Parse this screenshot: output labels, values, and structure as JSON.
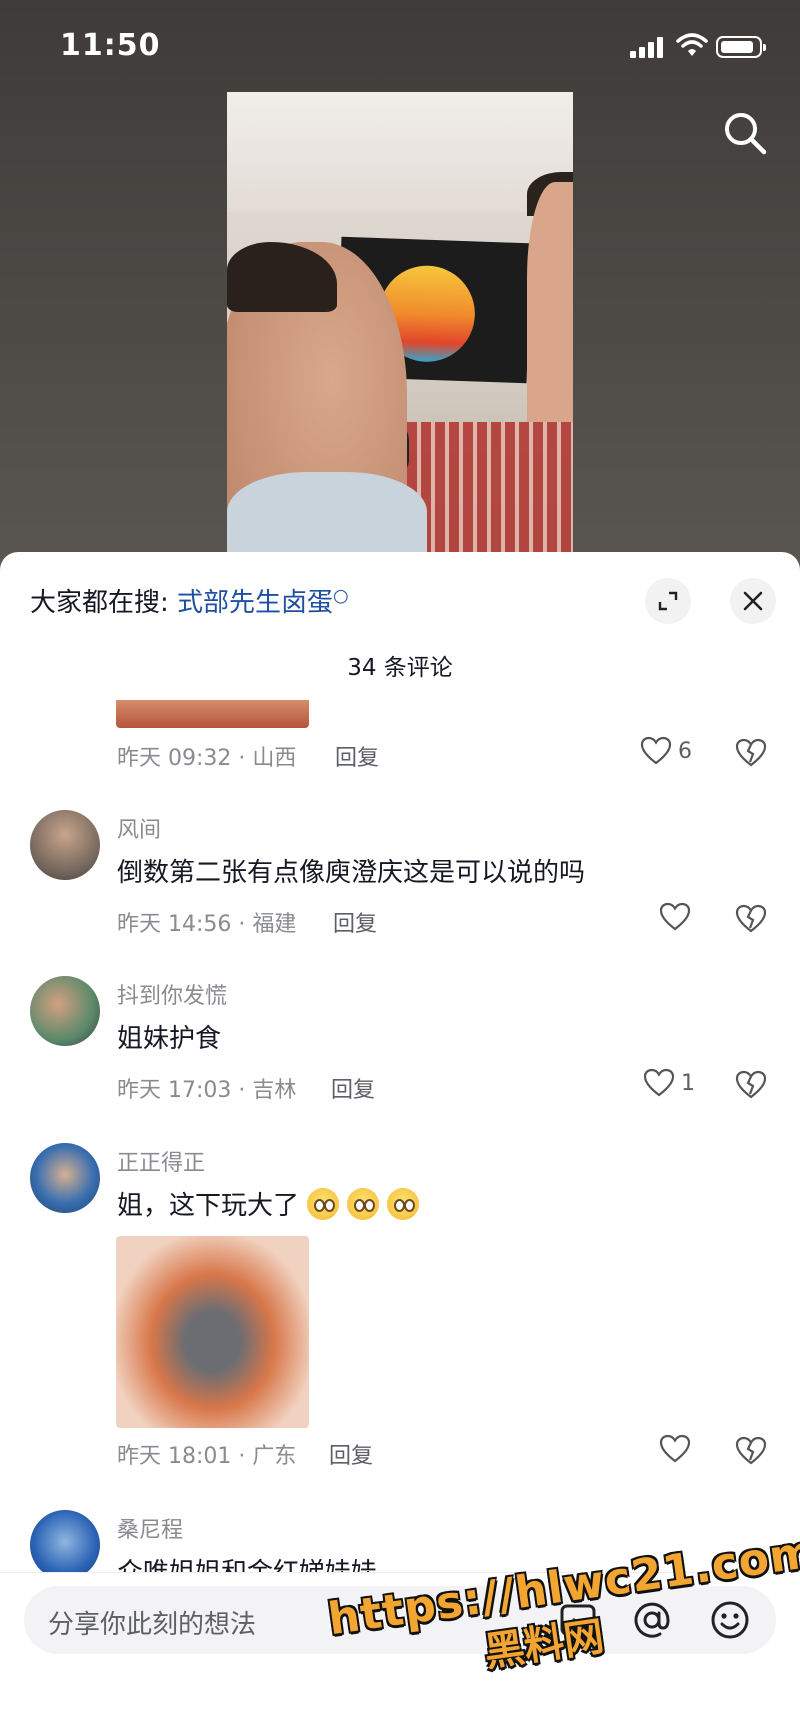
{
  "status_bar": {
    "time": "11:50"
  },
  "header": {
    "hot_search_prefix": "大家都在搜:",
    "hot_search_keyword": "式部先生卤蛋"
  },
  "comments_count_label": "34 条评论",
  "comments": [
    {
      "username": "",
      "text": "",
      "time": "昨天 09:32",
      "location": "· 山西",
      "reply": "回复",
      "likes": "6"
    },
    {
      "username": "风间",
      "text": "倒数第二张有点像庾澄庆这是可以说的吗",
      "time": "昨天 14:56",
      "location": "· 福建",
      "reply": "回复",
      "likes": ""
    },
    {
      "username": "抖到你发慌",
      "text": "姐妹护食",
      "time": "昨天 17:03",
      "location": "· 吉林",
      "reply": "回复",
      "likes": "1"
    },
    {
      "username": "正正得正",
      "text": "姐，这下玩大了",
      "time": "昨天 18:01",
      "location": "· 广东",
      "reply": "回复",
      "likes": ""
    },
    {
      "username": "桑尼程",
      "text": "众唯姐姐和金红娣娃娃"
    }
  ],
  "input_bar": {
    "placeholder": "分享你此刻的想法"
  },
  "watermark": {
    "url": "https://hlwc21.com",
    "name": "黑料网"
  },
  "icons": [
    "search-icon",
    "expand-icon",
    "close-icon",
    "heart-icon",
    "broken-heart-icon",
    "image-icon",
    "at-icon",
    "emoji-icon"
  ],
  "colors": {
    "keyword": "#1f4fa0",
    "watermark": "#f3a531"
  }
}
